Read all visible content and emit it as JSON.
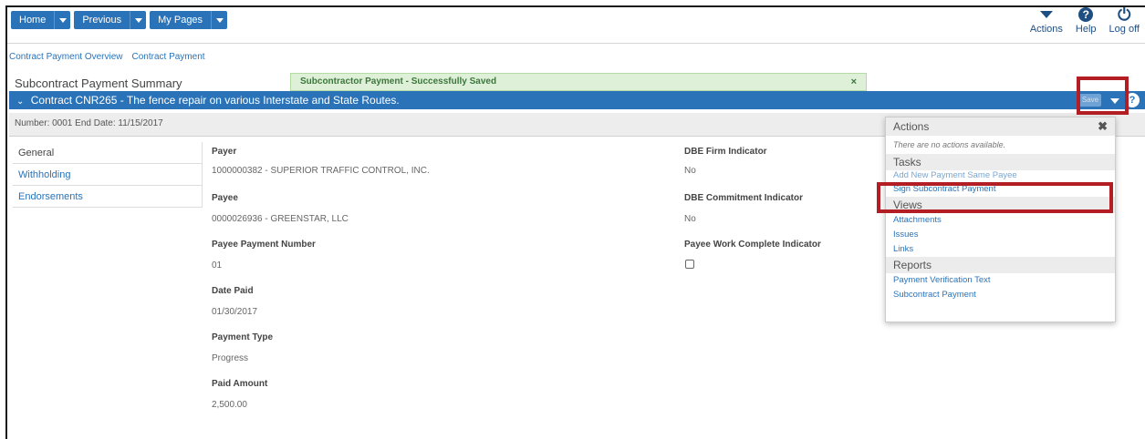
{
  "nav": {
    "home": "Home",
    "previous": "Previous",
    "my_pages": "My Pages"
  },
  "top_right": {
    "actions": "Actions",
    "help": "Help",
    "log_off": "Log off"
  },
  "breadcrumb": [
    "Contract Payment Overview",
    "Contract Payment"
  ],
  "page_title": "Subcontract Payment Summary",
  "toast": {
    "message": "Subcontractor Payment - Successfully Saved",
    "close": "×"
  },
  "contract_bar": {
    "title": "Contract CNR265 - The fence repair on various Interstate and State Routes.",
    "button": "Save"
  },
  "info_bar": "Number: 0001 End Date: 11/15/2017",
  "tabs": [
    "General",
    "Withholding",
    "Endorsements"
  ],
  "fields_left": [
    {
      "label": "Payer",
      "value": "1000000382 - SUPERIOR TRAFFIC CONTROL, INC."
    },
    {
      "label": "Payee",
      "value": "0000026936 - GREENSTAR, LLC"
    },
    {
      "label": "Payee Payment Number",
      "value": "01"
    },
    {
      "label": "Date Paid",
      "value": "01/30/2017"
    },
    {
      "label": "Payment Type",
      "value": "Progress"
    },
    {
      "label": "Paid Amount",
      "value": "2,500.00"
    }
  ],
  "fields_right": [
    {
      "label": "DBE Firm Indicator",
      "value": "No"
    },
    {
      "label": "DBE Commitment Indicator",
      "value": "No"
    },
    {
      "label": "Payee Work Complete Indicator",
      "value": ""
    }
  ],
  "actions_menu": {
    "title": "Actions",
    "close": "✖",
    "no_actions": "There are no actions available.",
    "tasks_title": "Tasks",
    "tasks": [
      "Add New Payment Same Payee",
      "Sign Subcontract Payment"
    ],
    "views_title": "Views",
    "views": [
      "Attachments",
      "Issues",
      "Links"
    ],
    "reports_title": "Reports",
    "reports": [
      "Payment Verification Text",
      "Subcontract Payment"
    ]
  },
  "colors": {
    "primary_blue": "#2a73b8",
    "highlight_red": "#b21e24",
    "toast_green": "#dff0d8"
  }
}
